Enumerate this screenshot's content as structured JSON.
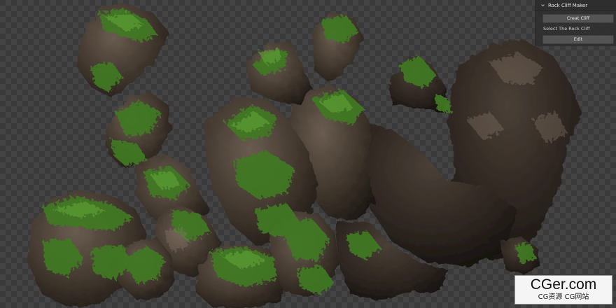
{
  "panel": {
    "title": "Rock Cliff Maker",
    "create_button": "Creat Cliff",
    "select_label": "Select The Rock Cliff",
    "edit_button": "Edit"
  },
  "watermark": {
    "main": "CGer.com",
    "sub": "CG资源 CG网站"
  },
  "colors": {
    "checker_dark": "#3a3a3a",
    "checker_light": "#444444",
    "rock": "#4a4038",
    "moss": "#3f7a24",
    "panel_bg": "#303030",
    "button_bg": "#545454"
  },
  "icons": {
    "collapse": "chevron-down-icon",
    "create": "rock-cliff-icon"
  }
}
